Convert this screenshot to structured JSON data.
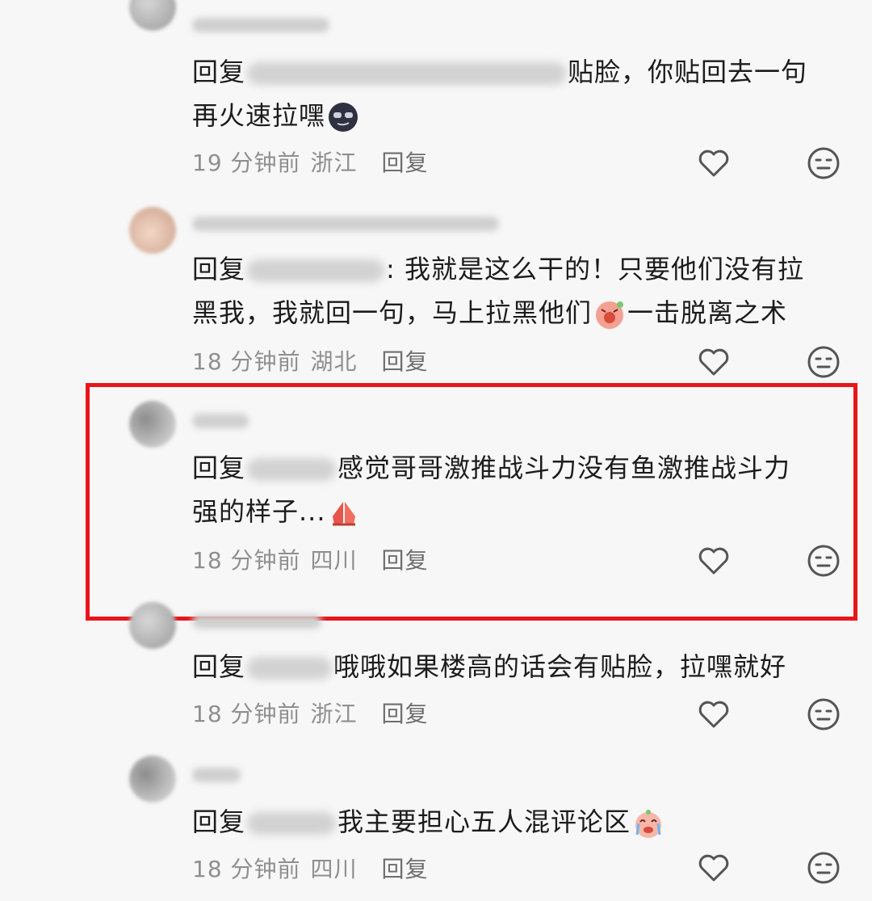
{
  "comments": [
    {
      "reply_prefix": "回复",
      "text": "贴脸，你贴回去一句",
      "text2": "再火速拉嘿",
      "time": "19 分钟前",
      "location": "浙江",
      "reply_label": "回复"
    },
    {
      "reply_prefix": "回复",
      "text": ": 我就是这么干的！只要他们没有拉",
      "text2": "黑我，我就回一句，马上拉黑他们",
      "text3": "一击脱离之术",
      "time": "18 分钟前",
      "location": "湖北",
      "reply_label": "回复"
    },
    {
      "reply_prefix": "回复",
      "text": "感觉哥哥激推战斗力没有鱼激推战斗力",
      "text2": "强的样子...",
      "time": "18 分钟前",
      "location": "四川",
      "reply_label": "回复"
    },
    {
      "reply_prefix": "回复",
      "text": "哦哦如果楼高的话会有贴脸，拉嘿就好",
      "time": "18 分钟前",
      "location": "浙江",
      "reply_label": "回复"
    },
    {
      "reply_prefix": "回复",
      "text": "我主要担心五人混评论区",
      "time": "18 分钟前",
      "location": "四川",
      "reply_label": "回复"
    }
  ],
  "icons": {
    "like": "heart-icon",
    "dislike": "neutral-face-icon"
  },
  "highlight_color": "#e8151b"
}
